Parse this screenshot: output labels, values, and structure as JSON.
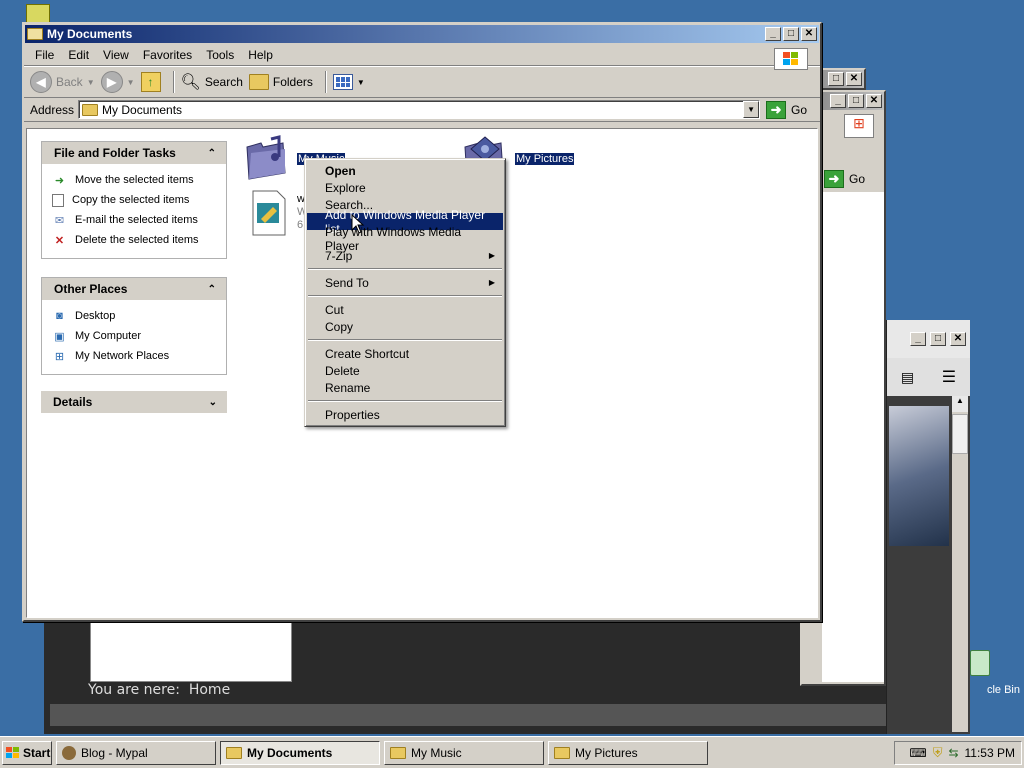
{
  "desktop": {
    "recycle_bin_label": "cle Bin"
  },
  "background_windows": {
    "browser_you_are_here": "You are nere:",
    "browser_home": "Home",
    "explorer2_go": "Go"
  },
  "window": {
    "title": "My Documents",
    "menu": [
      "File",
      "Edit",
      "View",
      "Favorites",
      "Tools",
      "Help"
    ],
    "toolbar": {
      "back": "Back",
      "search": "Search",
      "folders": "Folders"
    },
    "address_label": "Address",
    "address_value": "My Documents",
    "go_label": "Go"
  },
  "sidebar": {
    "file_tasks": {
      "title": "File and Folder Tasks",
      "items": [
        "Move the selected items",
        "Copy the selected items",
        "E-mail the selected items",
        "Delete the selected items"
      ]
    },
    "other_places": {
      "title": "Other Places",
      "items": [
        "Desktop",
        "My Computer",
        "My Network Places"
      ]
    },
    "details": {
      "title": "Details"
    }
  },
  "files": [
    {
      "name": "My Music",
      "selected": true
    },
    {
      "name": "My Pictures",
      "selected": true
    },
    {
      "name": "wi",
      "line2": "W",
      "line3": "6"
    }
  ],
  "context_menu": {
    "group1": [
      "Open",
      "Explore",
      "Search...",
      "Add to Windows Media Player list",
      "Play with Windows Media Player",
      "7-Zip"
    ],
    "group2": [
      "Send To"
    ],
    "group3": [
      "Cut",
      "Copy"
    ],
    "group4": [
      "Create Shortcut",
      "Delete",
      "Rename"
    ],
    "group5": [
      "Properties"
    ],
    "highlighted": "Add to Windows Media Player list"
  },
  "taskbar": {
    "start": "Start",
    "buttons": [
      "Blog - Mypal",
      "My Documents",
      "My Music",
      "My Pictures"
    ],
    "active": "My Documents",
    "clock": "11:53 PM"
  },
  "colors": {
    "desktop": "#3a6ea5",
    "titlebar_active": "#0a246a",
    "selection": "#0a246a"
  }
}
